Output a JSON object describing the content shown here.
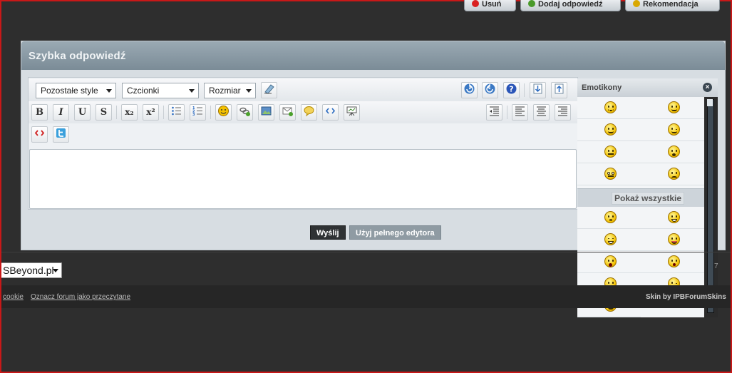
{
  "top_buttons": [
    {
      "label": "Usuń",
      "icon": "delete-icon",
      "color": "#d92020"
    },
    {
      "label": "Dodaj odpowiedź",
      "icon": "reply-icon",
      "color": "#4a9a2a"
    },
    {
      "label": "Rekomendacja",
      "icon": "recommend-icon",
      "color": "#d9a800"
    }
  ],
  "panel": {
    "title": "Szybka odpowiedź"
  },
  "editor": {
    "style_select": "Pozostałe style",
    "font_select": "Czcionki",
    "size_select": "Rozmiar",
    "bold": "B",
    "italic": "I",
    "underline": "U",
    "strike": "S",
    "subscript": "x₂",
    "superscript": "x²",
    "textarea_value": ""
  },
  "buttons": {
    "submit": "Wyślij",
    "full_editor": "Użyj pełnego edytora"
  },
  "emoticons": {
    "title": "Emotikony",
    "close": "×",
    "show_all": "Pokaż wszystkie"
  },
  "footer": {
    "skin_select": "SBeyond.pl",
    "links": [
      "cookie",
      "Oznacz forum jako przeczytane"
    ],
    "skin_by": "Skin by IPBForumSkins",
    "page_fragment": "7"
  },
  "colors": {
    "background": "#2e2e2e",
    "panel_header": "#7b8c97",
    "submit": "#2f3234",
    "full_editor": "#8f9ba3",
    "frame_border": "#c81818"
  }
}
